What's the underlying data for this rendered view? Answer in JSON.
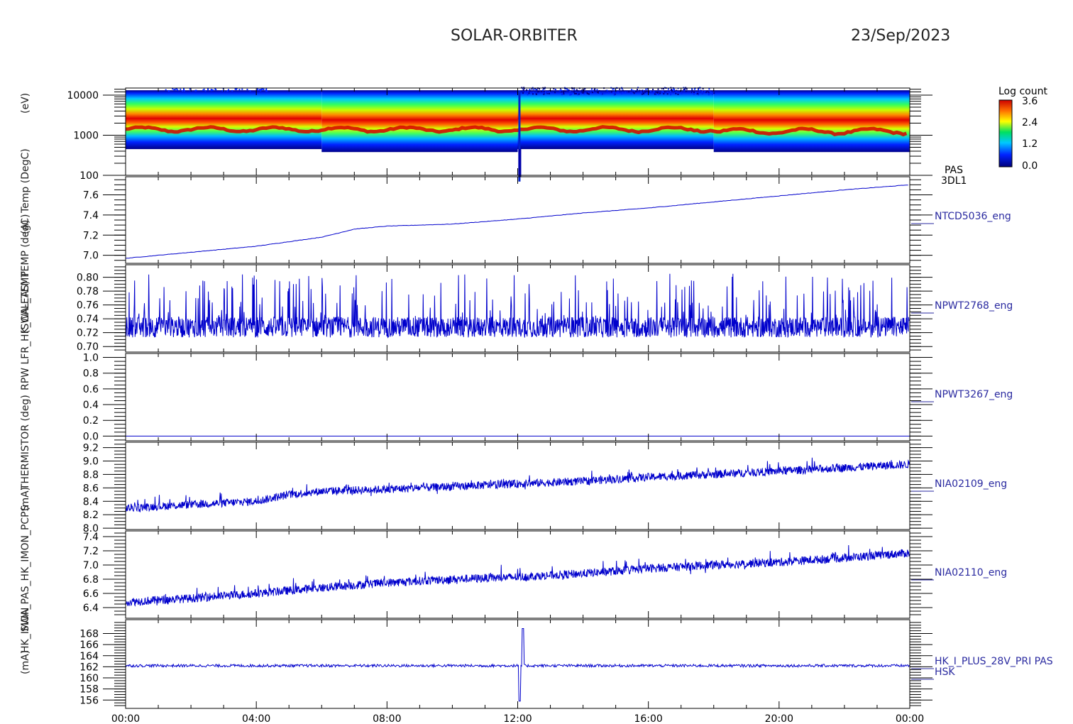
{
  "header": {
    "title": "SOLAR-ORBITER",
    "date": "23/Sep/2023"
  },
  "colorbar": {
    "title": "Log count",
    "ticks": [
      "3.6",
      "2.4",
      "1.2",
      "0.0"
    ]
  },
  "x_axis": {
    "ticks": [
      "00:00",
      "04:00",
      "08:00",
      "12:00",
      "16:00",
      "20:00",
      "00:00"
    ],
    "range_hours": [
      0,
      24
    ]
  },
  "y_axis_labels_overlapped": [
    "(eV)",
    "Temp (DegC)",
    "(A)",
    "(SWA-EAS) TEMP (degC)",
    "RPW LFR_HK_CAL_TEMP",
    "THERMISTOR (deg)",
    "(mA)",
    "SWA_PAS_HK_IMON_PCPS",
    "HK_IMON",
    "(mA)"
  ],
  "chart_data": [
    {
      "type": "heatmap",
      "panel_label": [
        "PAS",
        "3DL1"
      ],
      "yscale": "log",
      "ylim": [
        100,
        15000
      ],
      "ytick_labels": [
        "10000",
        "1000",
        "100"
      ],
      "colorbar_range": [
        0.0,
        3.6
      ],
      "peak_energy_ev": 1400,
      "lower_cutoff_ev": {
        "00:00-06:00": 450,
        "06:00-12:00": 380,
        "12:00-18:00": 450,
        "18:00-24:00": 380
      }
    },
    {
      "type": "line",
      "series_label": "NTCD5036_eng",
      "color": "#0000cc",
      "ylim": [
        6.92,
        7.78
      ],
      "ytick_labels": [
        "7.6",
        "7.4",
        "7.2",
        "7.0"
      ],
      "x": [
        0,
        2,
        4,
        6,
        7,
        8,
        10,
        12,
        14,
        16,
        18,
        20,
        22,
        24
      ],
      "values": [
        6.97,
        7.03,
        7.09,
        7.18,
        7.26,
        7.29,
        7.31,
        7.36,
        7.42,
        7.47,
        7.53,
        7.59,
        7.65,
        7.7
      ]
    },
    {
      "type": "line",
      "series_label": "NPWT2768_eng",
      "color": "#0000cc",
      "ylim": [
        0.692,
        0.818
      ],
      "ytick_labels": [
        "0.80",
        "0.78",
        "0.76",
        "0.74",
        "0.72",
        "0.70"
      ],
      "baseline": 0.728,
      "noise_min": 0.708,
      "spike_max": 0.805
    },
    {
      "type": "line",
      "series_label": "NPWT3267_eng",
      "color": "#0000cc",
      "ylim": [
        -0.06,
        1.05
      ],
      "ytick_labels": [
        "1.0",
        "0.8",
        "0.6",
        "0.4",
        "0.2",
        "0.0"
      ],
      "x": [
        0,
        24
      ],
      "values": [
        0.0,
        0.0
      ]
    },
    {
      "type": "line",
      "series_label": "NIA02109_eng",
      "color": "#0000cc",
      "ylim": [
        7.98,
        9.28
      ],
      "ytick_labels": [
        "9.2",
        "9.0",
        "8.8",
        "8.6",
        "8.4",
        "8.2",
        "8.0"
      ],
      "x": [
        0,
        2,
        4,
        5,
        6,
        8,
        10,
        12,
        14,
        16,
        18,
        20,
        22,
        24
      ],
      "values": [
        8.3,
        8.35,
        8.4,
        8.5,
        8.55,
        8.58,
        8.62,
        8.66,
        8.7,
        8.76,
        8.8,
        8.85,
        8.9,
        8.95
      ]
    },
    {
      "type": "line",
      "series_label": "NIA02110_eng",
      "color": "#0000cc",
      "ylim": [
        6.25,
        7.48
      ],
      "ytick_labels": [
        "7.4",
        "7.2",
        "7.0",
        "6.8",
        "6.6",
        "6.4"
      ],
      "x": [
        0,
        2,
        4,
        6,
        8,
        10,
        12,
        14,
        16,
        18,
        20,
        22,
        24
      ],
      "values": [
        6.48,
        6.53,
        6.6,
        6.68,
        6.75,
        6.8,
        6.83,
        6.88,
        6.95,
        7.0,
        7.04,
        7.1,
        7.17
      ]
    },
    {
      "type": "line",
      "series_label": [
        "HK_I_PLUS_28V_PRI PAS",
        "HSK"
      ],
      "color": "#0000cc",
      "ylim": [
        154.5,
        170.5
      ],
      "ytick_labels": [
        "168",
        "166",
        "164",
        "162",
        "160",
        "158",
        "156"
      ],
      "baseline": 162.2,
      "event_time_h": 12.05,
      "event_min": 155.8,
      "event_max": 168.9
    }
  ]
}
